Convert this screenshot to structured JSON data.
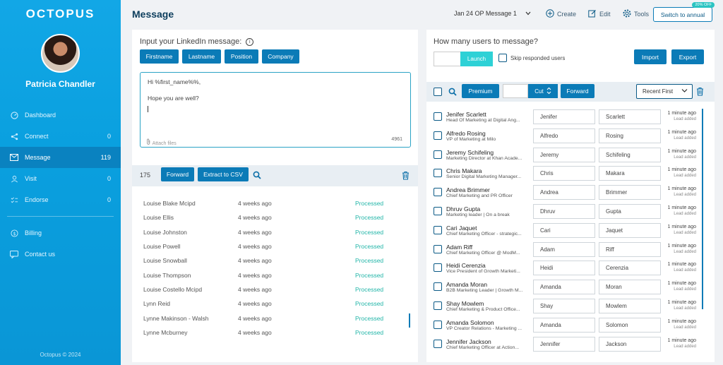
{
  "brand": {
    "logo": "OCTOPUS",
    "copyright": "Octopus © 2024"
  },
  "user": {
    "name": "Patricia Chandler"
  },
  "sidebar": {
    "items": [
      {
        "label": "Dashboard",
        "count": "",
        "icon": "dashboard-icon"
      },
      {
        "label": "Connect",
        "count": "0",
        "icon": "share-icon"
      },
      {
        "label": "Message",
        "count": "119",
        "icon": "envelope-icon"
      },
      {
        "label": "Visit",
        "count": "0",
        "icon": "user-icon"
      },
      {
        "label": "Endorse",
        "count": "0",
        "icon": "check-list-icon"
      }
    ],
    "secondary": [
      {
        "label": "Billing",
        "icon": "billing-icon"
      },
      {
        "label": "Contact us",
        "icon": "chat-icon"
      }
    ]
  },
  "topbar": {
    "title": "Message",
    "campaign_select": "Jan 24 OP Message 1",
    "create": "Create",
    "edit": "Edit",
    "tools": "Tools",
    "switch_annual": "Switch to annual",
    "off_badge": "20% OFF"
  },
  "composer": {
    "label": "Input your LinkedIn message:",
    "var_buttons": [
      "Firstname",
      "Lastname",
      "Position",
      "Company"
    ],
    "line1": "Hi %first_name%%,",
    "line2": "Hope you are well?",
    "attach": "Attach files",
    "char_count": "4961"
  },
  "left_toolbar": {
    "count": "175",
    "forward": "Forward",
    "extract": "Extract to CSV"
  },
  "processed": [
    {
      "name": "Louise Blake Mcipd",
      "when": "4 weeks ago",
      "status": "Processed"
    },
    {
      "name": "Louise Ellis",
      "when": "4 weeks ago",
      "status": "Processed"
    },
    {
      "name": "Louise Johnston",
      "when": "4 weeks ago",
      "status": "Processed"
    },
    {
      "name": "Louise Powell",
      "when": "4 weeks ago",
      "status": "Processed"
    },
    {
      "name": "Louise Snowball",
      "when": "4 weeks ago",
      "status": "Processed"
    },
    {
      "name": "Louise Thompson",
      "when": "4 weeks ago",
      "status": "Processed"
    },
    {
      "name": "Louise Costello Mcipd",
      "when": "4 weeks ago",
      "status": "Processed"
    },
    {
      "name": "Lynn Reid",
      "when": "4 weeks ago",
      "status": "Processed"
    },
    {
      "name": "Lynne Makinson - Walsh",
      "when": "4 weeks ago",
      "status": "Processed"
    },
    {
      "name": "Lynne Mcburney",
      "when": "4 weeks ago",
      "status": "Processed"
    }
  ],
  "right_header": {
    "question": "How many users to message?",
    "launch": "Launch",
    "skip": "Skip responded users",
    "import": "Import",
    "export": "Export",
    "premium": "Premium",
    "cut": "Cut",
    "forward": "Forward",
    "sort": "Recent First"
  },
  "users": [
    {
      "name": "Jenifer Scarlett",
      "title": "Head Of Marketing at Digital Ang...",
      "first": "Jenifer",
      "last": "Scarlett",
      "time": "1 minute ago",
      "sub": "Lead added"
    },
    {
      "name": "Alfredo Rosing",
      "title": "VP of Marketing at Milo",
      "first": "Alfredo",
      "last": "Rosing",
      "time": "1 minute ago",
      "sub": "Lead added"
    },
    {
      "name": "Jeremy Schifeling",
      "title": "Marketing Director at Khan Acade...",
      "first": "Jeremy",
      "last": "Schifeling",
      "time": "1 minute ago",
      "sub": "Lead added"
    },
    {
      "name": "Chris Makara",
      "title": "Senior Digital Marketing Manager...",
      "first": "Chris",
      "last": "Makara",
      "time": "1 minute ago",
      "sub": "Lead added"
    },
    {
      "name": "Andrea Brimmer",
      "title": "Chief Marketing and PR Officer",
      "first": "Andrea",
      "last": "Brimmer",
      "time": "1 minute ago",
      "sub": "Lead added"
    },
    {
      "name": "Dhruv Gupta",
      "title": "Marketing leader | On a break",
      "first": "Dhruv",
      "last": "Gupta",
      "time": "1 minute ago",
      "sub": "Lead added"
    },
    {
      "name": "Cari Jaquet",
      "title": "Chief Marketing Officer - strategic...",
      "first": "Cari",
      "last": "Jaquet",
      "time": "1 minute ago",
      "sub": "Lead added"
    },
    {
      "name": "Adam Riff",
      "title": "Chief Marketing Officer @ ModM...",
      "first": "Adam",
      "last": "Riff",
      "time": "1 minute ago",
      "sub": "Lead added"
    },
    {
      "name": "Heidi Cerenzia",
      "title": "Vice President of Growth Marketi...",
      "first": "Heidi",
      "last": "Cerenzia",
      "time": "1 minute ago",
      "sub": "Lead added"
    },
    {
      "name": "Amanda Moran",
      "title": "B2B Marketing Leader | Growth M...",
      "first": "Amanda",
      "last": "Moran",
      "time": "1 minute ago",
      "sub": "Lead added"
    },
    {
      "name": "Shay Mowlem",
      "title": "Chief Marketing & Product Office...",
      "first": "Shay",
      "last": "Mowlem",
      "time": "1 minute ago",
      "sub": "Lead added"
    },
    {
      "name": "Amanda Solomon",
      "title": "VP Creator Relations - Marketing ...",
      "first": "Amanda",
      "last": "Solomon",
      "time": "1 minute ago",
      "sub": "Lead added"
    },
    {
      "name": "Jennifer Jackson",
      "title": "Chief Marketing Officer at Action...",
      "first": "Jennifer",
      "last": "Jackson",
      "time": "1 minute ago",
      "sub": "Lead added"
    }
  ]
}
